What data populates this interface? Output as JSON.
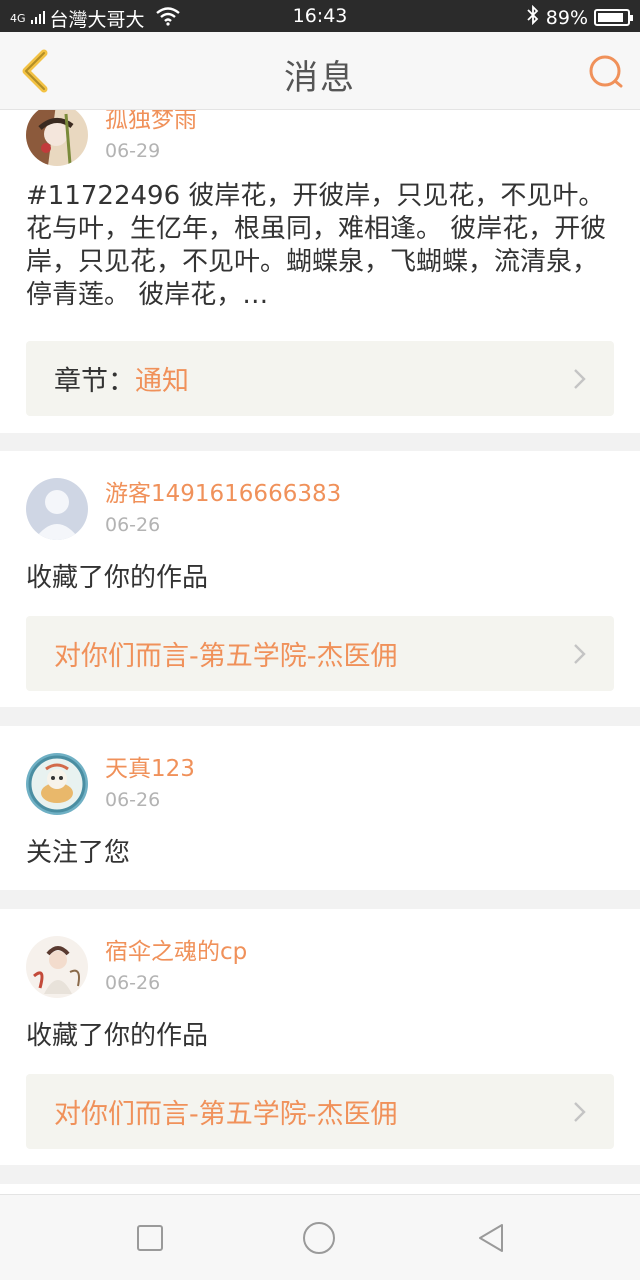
{
  "status_bar": {
    "network": "4G",
    "carrier": "台灣大哥大",
    "time": "16:43",
    "battery": "89%",
    "battery_level": 0.89
  },
  "header": {
    "title": "消息",
    "back_icon": "chevron-left-icon",
    "search_icon": "search-icon"
  },
  "colors": {
    "accent": "#f0915a",
    "link_bg": "#f4f4ef"
  },
  "messages": [
    {
      "user": "孤独梦雨",
      "date": "06-29",
      "text": "#11722496 彼岸花，开彼岸，只见花，不见叶。花与叶，生亿年，根虽同，难相逢。 彼岸花，开彼岸，只见花，不见叶。蝴蝶泉，飞蝴蝶，流清泉，停青莲。 彼岸花，…",
      "link_label": "章节：",
      "link_value": "通知"
    },
    {
      "user": "游客1491616666383",
      "date": "06-26",
      "text": "收藏了你的作品",
      "link_value": "对你们而言-第五学院-杰医佣"
    },
    {
      "user": "天真123",
      "date": "06-26",
      "text": "关注了您"
    },
    {
      "user": "宿伞之魂的cp",
      "date": "06-26",
      "text": "收藏了你的作品",
      "link_value": "对你们而言-第五学院-杰医佣"
    }
  ],
  "nav_buttons": [
    "recents-square-icon",
    "home-circle-icon",
    "back-triangle-icon"
  ]
}
